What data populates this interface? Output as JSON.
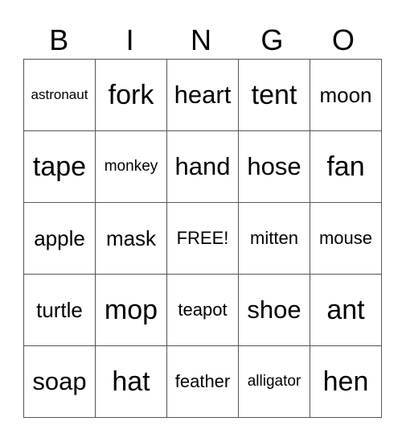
{
  "header": [
    "B",
    "I",
    "N",
    "G",
    "O"
  ],
  "rows": [
    [
      {
        "text": "astronaut",
        "size": "xxs"
      },
      {
        "text": "fork",
        "size": "xl"
      },
      {
        "text": "heart",
        "size": "l"
      },
      {
        "text": "tent",
        "size": "xl"
      },
      {
        "text": "moon",
        "size": "m"
      }
    ],
    [
      {
        "text": "tape",
        "size": "xl"
      },
      {
        "text": "monkey",
        "size": "xs"
      },
      {
        "text": "hand",
        "size": "l"
      },
      {
        "text": "hose",
        "size": "l"
      },
      {
        "text": "fan",
        "size": "xl"
      }
    ],
    [
      {
        "text": "apple",
        "size": "m"
      },
      {
        "text": "mask",
        "size": "m"
      },
      {
        "text": "FREE!",
        "size": "s"
      },
      {
        "text": "mitten",
        "size": "s"
      },
      {
        "text": "mouse",
        "size": "s"
      }
    ],
    [
      {
        "text": "turtle",
        "size": "m"
      },
      {
        "text": "mop",
        "size": "xl"
      },
      {
        "text": "teapot",
        "size": "s"
      },
      {
        "text": "shoe",
        "size": "l"
      },
      {
        "text": "ant",
        "size": "xl"
      }
    ],
    [
      {
        "text": "soap",
        "size": "l"
      },
      {
        "text": "hat",
        "size": "xl"
      },
      {
        "text": "feather",
        "size": "s"
      },
      {
        "text": "alligator",
        "size": "xs"
      },
      {
        "text": "hen",
        "size": "xl"
      }
    ]
  ]
}
